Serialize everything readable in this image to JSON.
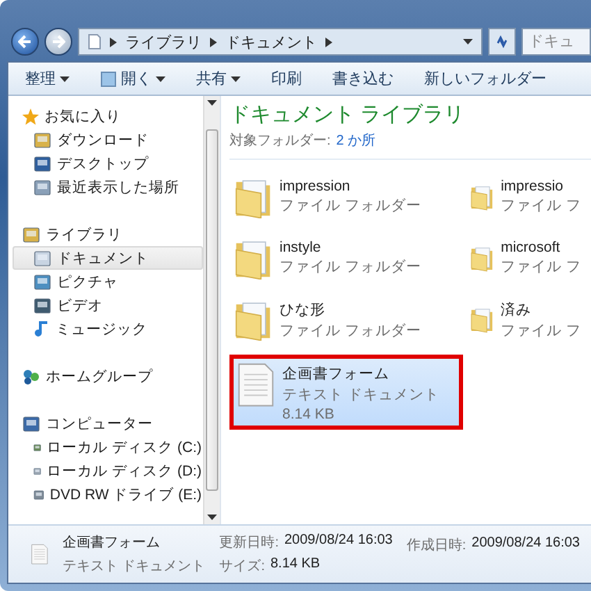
{
  "address": {
    "crumbs": [
      "ライブラリ",
      "ドキュメント"
    ]
  },
  "search": {
    "placeholder": "ドキュ"
  },
  "toolbar": [
    {
      "label": "整理",
      "dropdown": true,
      "icon": false
    },
    {
      "label": "開く",
      "dropdown": true,
      "icon": true
    },
    {
      "label": "共有",
      "dropdown": true,
      "icon": false
    },
    {
      "label": "印刷",
      "dropdown": false,
      "icon": false
    },
    {
      "label": "書き込む",
      "dropdown": false,
      "icon": false
    },
    {
      "label": "新しいフォルダー",
      "dropdown": false,
      "icon": false
    }
  ],
  "sidebar": [
    {
      "label": "お気に入り",
      "children": [
        {
          "label": "ダウンロード",
          "selected": false
        },
        {
          "label": "デスクトップ",
          "selected": false
        },
        {
          "label": "最近表示した場所",
          "selected": false
        }
      ]
    },
    {
      "label": "ライブラリ",
      "children": [
        {
          "label": "ドキュメント",
          "selected": true
        },
        {
          "label": "ピクチャ",
          "selected": false
        },
        {
          "label": "ビデオ",
          "selected": false
        },
        {
          "label": "ミュージック",
          "selected": false
        }
      ]
    },
    {
      "label": "ホームグループ"
    },
    {
      "label": "コンピューター",
      "children": [
        {
          "label": "ローカル ディスク (C:)",
          "selected": false
        },
        {
          "label": "ローカル ディスク (D:)",
          "selected": false
        },
        {
          "label": "DVD RW ドライブ (E:)",
          "selected": false
        }
      ]
    }
  ],
  "library": {
    "title": "ドキュメント ライブラリ",
    "target_label": "対象フォルダー:",
    "target_link": "2 か所"
  },
  "items": [
    {
      "kind": "folder",
      "name": "impression",
      "type": "ファイル フォルダー",
      "selected": false,
      "annotated": false
    },
    {
      "kind": "folder",
      "name": "impressio",
      "type": "ファイル フ",
      "selected": false,
      "annotated": false
    },
    {
      "kind": "folder",
      "name": "instyle",
      "type": "ファイル フォルダー",
      "selected": false,
      "annotated": false
    },
    {
      "kind": "folder",
      "name": "microsoft",
      "type": "ファイル フ",
      "selected": false,
      "annotated": false
    },
    {
      "kind": "folder",
      "name": "ひな形",
      "type": "ファイル フォルダー",
      "selected": false,
      "annotated": false
    },
    {
      "kind": "folder",
      "name": "済み",
      "type": "ファイル フ",
      "selected": false,
      "annotated": false
    },
    {
      "kind": "file",
      "name": "企画書フォーム",
      "type": "テキスト ドキュメント",
      "size": "8.14 KB",
      "selected": true,
      "annotated": true
    }
  ],
  "details": {
    "name": "企画書フォーム",
    "type": "テキスト ドキュメント",
    "fields": [
      {
        "label": "更新日時:",
        "value": "2009/08/24 16:03"
      },
      {
        "label": "サイズ:",
        "value": "8.14 KB"
      },
      {
        "label": "作成日時:",
        "value": "2009/08/24 16:03"
      }
    ]
  }
}
